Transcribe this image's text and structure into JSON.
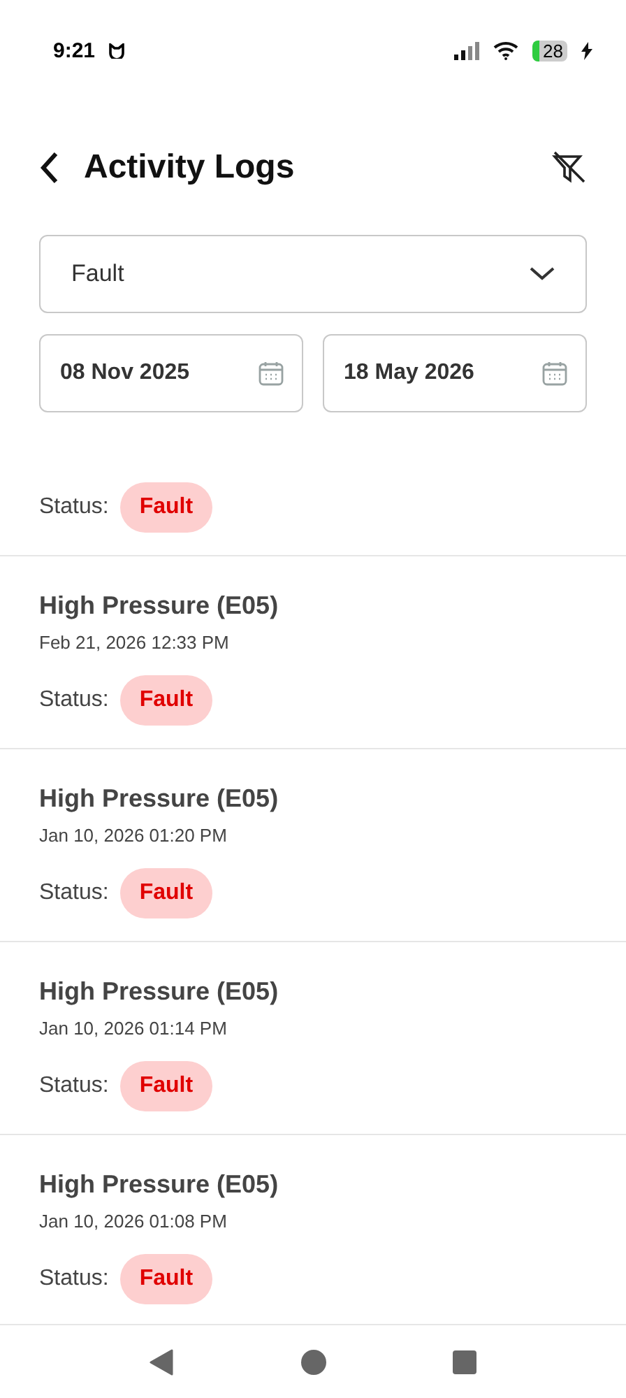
{
  "status_bar": {
    "time": "9:21",
    "battery": "28"
  },
  "header": {
    "title": "Activity Logs"
  },
  "filter": {
    "value": "Fault"
  },
  "dates": [
    {
      "value": "08 Nov 2025"
    },
    {
      "value": "18 May 2026"
    }
  ],
  "logs": [
    {
      "status_label": "Status:",
      "status": "Fault"
    },
    {
      "title": "High Pressure (E05)",
      "time": "Feb 21, 2026 12:33 PM",
      "status_label": "Status:",
      "status": "Fault"
    },
    {
      "title": "High Pressure (E05)",
      "time": "Jan 10, 2026 01:20 PM",
      "status_label": "Status:",
      "status": "Fault"
    },
    {
      "title": "High Pressure (E05)",
      "time": "Jan 10, 2026 01:14 PM",
      "status_label": "Status:",
      "status": "Fault"
    },
    {
      "title": "High Pressure (E05)",
      "time": "Jan 10, 2026 01:08 PM",
      "status_label": "Status:",
      "status": "Fault"
    }
  ]
}
